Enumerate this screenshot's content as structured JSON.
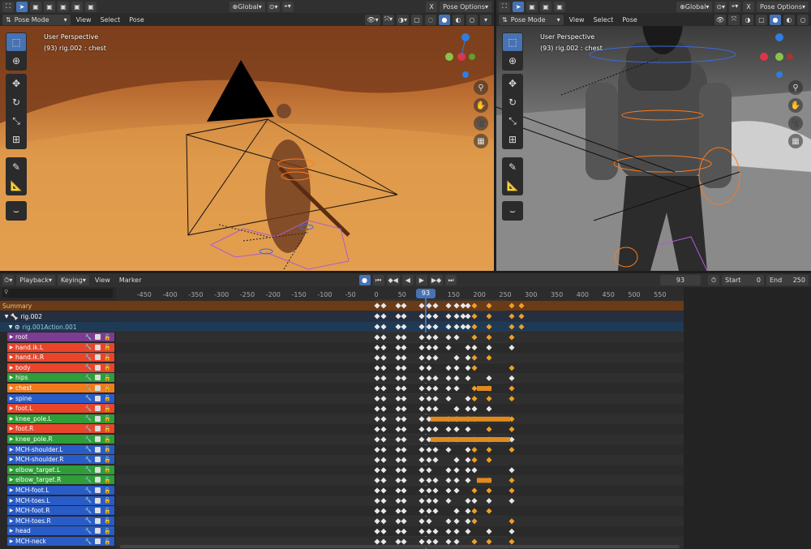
{
  "left_view": {
    "mode": "Pose Mode",
    "menus": [
      "View",
      "Select",
      "Pose"
    ],
    "orientation": "Global",
    "options": "Pose Options",
    "perspective": "User Perspective",
    "active": "(93) rig.002 : chest"
  },
  "right_view": {
    "mode": "Pose Mode",
    "menus": [
      "View",
      "Select",
      "Pose"
    ],
    "orientation": "Global",
    "options": "Pose Options",
    "perspective": "User Perspective",
    "active": "(93) rig.002 : chest"
  },
  "timeline": {
    "menus": [
      "Playback",
      "Keying",
      "View",
      "Marker"
    ],
    "current_frame": "93",
    "start_label": "Start",
    "start": "0",
    "end_label": "End",
    "end": "250"
  },
  "dopesheet": {
    "ticks": [
      "-450",
      "-400",
      "-350",
      "-300",
      "-250",
      "-200",
      "-150",
      "-100",
      "-50",
      "0",
      "50",
      "100",
      "150",
      "200",
      "250",
      "300",
      "350",
      "400",
      "450",
      "500",
      "550"
    ],
    "frame_badge": "93",
    "summary": "Summary",
    "object": "rig.002",
    "action": "rig.001Action.001",
    "channels": [
      {
        "name": "root",
        "color": "#7c3c91"
      },
      {
        "name": "hand.ik.L",
        "color": "#e8452b"
      },
      {
        "name": "hand.ik.R",
        "color": "#e8452b"
      },
      {
        "name": "body",
        "color": "#e8452b"
      },
      {
        "name": "hips",
        "color": "#2e9d3a"
      },
      {
        "name": "chest",
        "color": "#f07b1c"
      },
      {
        "name": "spine",
        "color": "#2a5cc7"
      },
      {
        "name": "foot.L",
        "color": "#e8452b"
      },
      {
        "name": "knee_pole.L",
        "color": "#2e9d3a"
      },
      {
        "name": "foot.R",
        "color": "#e8452b"
      },
      {
        "name": "knee_pole.R",
        "color": "#2e9d3a"
      },
      {
        "name": "MCH-shoulder.L",
        "color": "#2a5cc7"
      },
      {
        "name": "MCH-shoulder.R",
        "color": "#2a5cc7"
      },
      {
        "name": "elbow_target.L",
        "color": "#2e9d3a"
      },
      {
        "name": "elbow_target.R",
        "color": "#2e9d3a"
      },
      {
        "name": "MCH-foot.L",
        "color": "#2a5cc7"
      },
      {
        "name": "MCH-toes.L",
        "color": "#2a5cc7"
      },
      {
        "name": "MCH-foot.R",
        "color": "#2a5cc7"
      },
      {
        "name": "MCH-toes.R",
        "color": "#2a5cc7"
      },
      {
        "name": "head",
        "color": "#2a5cc7"
      },
      {
        "name": "MCH-neck",
        "color": "#2a5cc7"
      }
    ]
  },
  "icons": [
    "select-box-icon",
    "cursor-icon",
    "move-icon",
    "rotate-icon",
    "scale-icon",
    "transform-icon",
    "annotate-icon",
    "measure-icon",
    "pose-relax-icon",
    "zoom-icon",
    "hand-icon",
    "camera-icon",
    "grid-icon"
  ]
}
